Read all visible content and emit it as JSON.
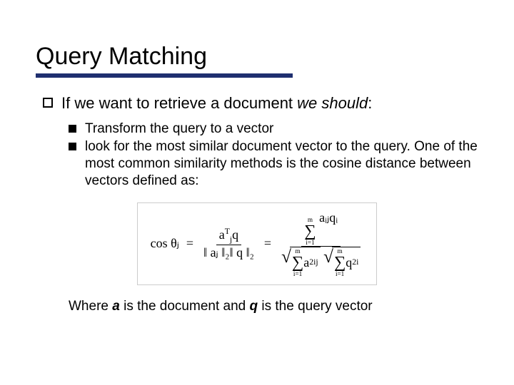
{
  "title": "Query Matching",
  "main_bullet": {
    "pre": "If we want to retrieve a document ",
    "italic": "we should",
    "post": ":"
  },
  "sub_bullets": [
    "Transform the query to a vector",
    " look for the most similar document vector to the query. One of the most common similarity methods is the cosine distance between vectors defined as:"
  ],
  "formula": {
    "lhs": "cos θⱼ",
    "frac1_num_base": "a",
    "frac1_num_sub": "j",
    "frac1_num_sup": "T",
    "frac1_num_tail": "q",
    "frac1_den": "‖ aⱼ ‖₂‖ q ‖₂",
    "sum_upper": "m",
    "sum_lower": "i=1",
    "sum_num_term": "aᵢⱼqᵢ",
    "sqrt1_term": "a",
    "sqrt1_sub": "ij",
    "sqrt1_sup": "2",
    "sqrt2_term": "q",
    "sqrt2_sub": "i",
    "sqrt2_sup": "2"
  },
  "closing": {
    "p1": "Where ",
    "a": "a",
    "p2": " is the document and ",
    "q": "q",
    "p3": " is the query vector"
  }
}
